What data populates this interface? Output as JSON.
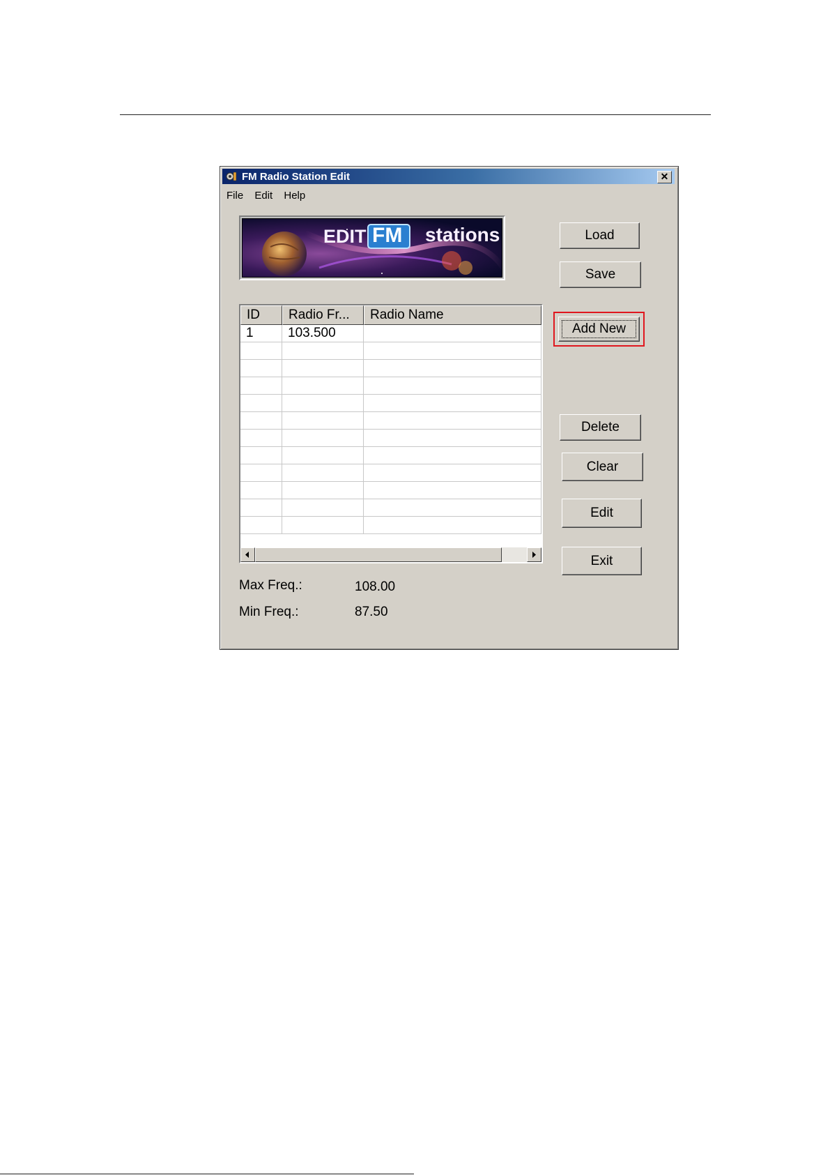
{
  "window": {
    "title": "FM Radio Station Edit",
    "close_label": "✕"
  },
  "menu": [
    "File",
    "Edit",
    "Help"
  ],
  "banner": {
    "edit_text": "EDIT",
    "fm_text": "FM",
    "stations_text": "stations"
  },
  "buttons": {
    "load": "Load",
    "save": "Save",
    "add_new": "Add New",
    "delete": "Delete",
    "clear": "Clear",
    "edit": "Edit",
    "exit": "Exit"
  },
  "list": {
    "columns": [
      "ID",
      "Radio Fr...",
      "Radio Name"
    ],
    "rows": [
      {
        "id": "1",
        "freq": "103.500",
        "name": ""
      }
    ]
  },
  "freq": {
    "max_label": "Max Freq.:",
    "max_value": "108.00",
    "min_label": "Min Freq.:",
    "min_value": "87.50"
  },
  "colors": {
    "focus_highlight": "#e0161e",
    "title_gradient_start": "#0a246a",
    "title_gradient_end": "#a6caf0"
  }
}
